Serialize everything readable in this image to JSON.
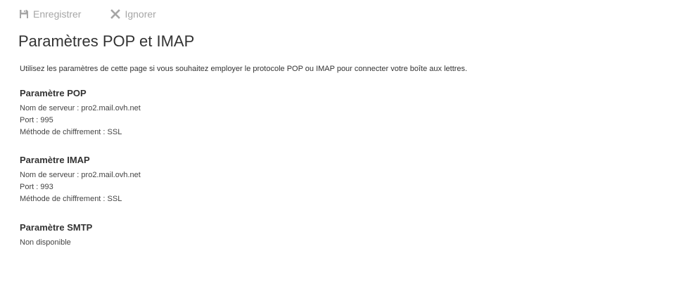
{
  "toolbar": {
    "save_label": "Enregistrer",
    "save_icon": "floppy-disk-icon",
    "ignore_label": "Ignorer",
    "ignore_icon": "close-icon",
    "disabled_color": "#a6a6a6"
  },
  "page": {
    "title": "Paramètres POP et IMAP",
    "intro": "Utilisez les paramètres de cette page si vous souhaitez employer le protocole POP ou IMAP pour connecter votre boîte aux lettres."
  },
  "pop": {
    "heading": "Paramètre POP",
    "server": "Nom de serveur : pro2.mail.ovh.net",
    "port": "Port : 995",
    "encryption": "Méthode de chiffrement : SSL"
  },
  "imap": {
    "heading": "Paramètre IMAP",
    "server": "Nom de serveur : pro2.mail.ovh.net",
    "port": "Port : 993",
    "encryption": "Méthode de chiffrement : SSL"
  },
  "smtp": {
    "heading": "Paramètre SMTP",
    "status": "Non disponible"
  }
}
